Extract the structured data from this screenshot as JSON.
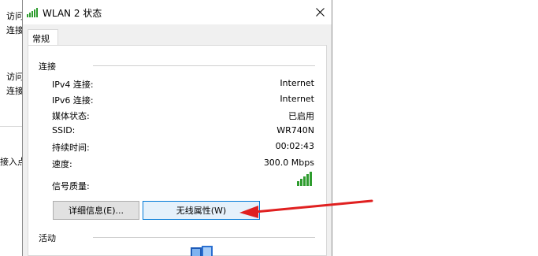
{
  "background_window": {
    "lines": [
      "访问",
      "连接",
      "访问",
      "连接",
      "接入点"
    ]
  },
  "dialog": {
    "title": "WLAN 2 状态",
    "tab": "常规",
    "connection_section": "连接",
    "rows": [
      {
        "label": "IPv4 连接:",
        "value": "Internet"
      },
      {
        "label": "IPv6 连接:",
        "value": "Internet"
      },
      {
        "label": "媒体状态:",
        "value": "已启用"
      },
      {
        "label": "SSID:",
        "value": "WR740N"
      },
      {
        "label": "持续时间:",
        "value": "00:02:43"
      },
      {
        "label": "速度:",
        "value": "300.0 Mbps"
      }
    ],
    "signal_label": "信号质量:",
    "signal_strength": "5/5",
    "details_button": "详细信息(E)...",
    "wireless_props_button": "无线属性(W)",
    "activity_section": "活动"
  },
  "colors": {
    "signal_green": "#2e9c2e",
    "arrow_red": "#e02020",
    "focus_blue": "#0078d7"
  }
}
